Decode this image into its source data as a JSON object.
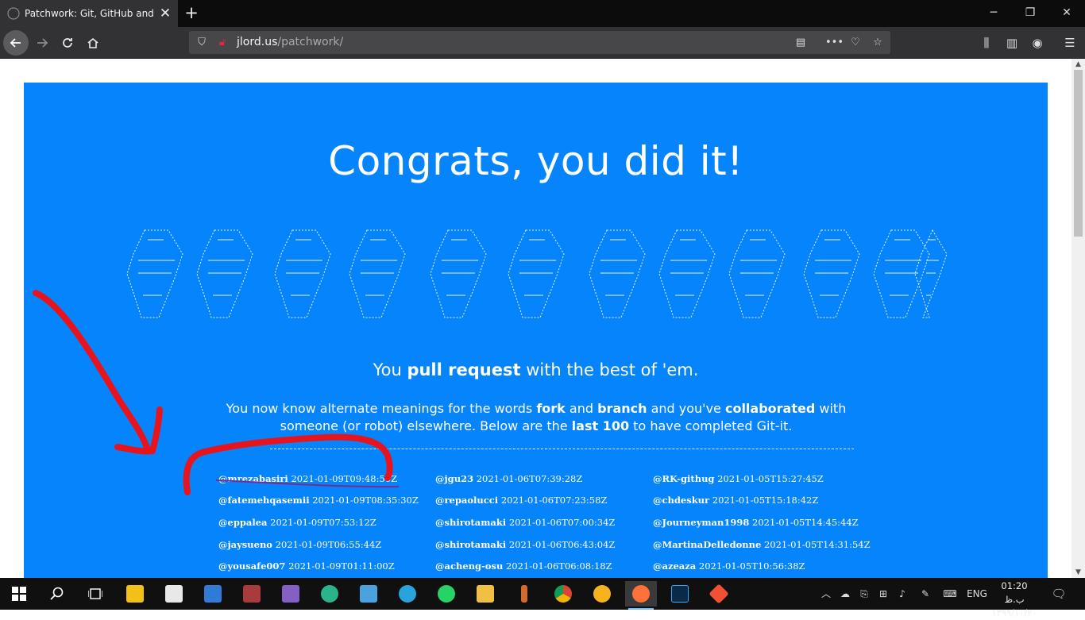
{
  "browser": {
    "tab_title": "Patchwork: Git, GitHub and the",
    "url_host": "jlord.us",
    "url_path": "/patchwork/"
  },
  "page": {
    "heading": "Congrats, you did it!",
    "tagline_prefix": "You ",
    "tagline_bold": "pull request",
    "tagline_suffix": " with the best of 'em.",
    "desc_1": "You now know alternate meanings for the words ",
    "desc_fork": "fork",
    "desc_2": " and ",
    "desc_branch": "branch",
    "desc_3": " and you've ",
    "desc_collab": "collaborated",
    "desc_4": " with someone (or robot) elsewhere. Below are the ",
    "desc_last": "last 100",
    "desc_5": " to have completed Git-it."
  },
  "completions": [
    [
      {
        "user": "@mrezabasiri",
        "time": "2021-01-09T09:48:50Z"
      },
      {
        "user": "@fatemehqasemii",
        "time": "2021-01-09T08:35:30Z"
      },
      {
        "user": "@eppalea",
        "time": "2021-01-09T07:53:12Z"
      },
      {
        "user": "@jaysueno",
        "time": "2021-01-09T06:55:44Z"
      },
      {
        "user": "@yousafe007",
        "time": "2021-01-09T01:11:00Z"
      }
    ],
    [
      {
        "user": "@jgu23",
        "time": "2021-01-06T07:39:28Z"
      },
      {
        "user": "@repaolucci",
        "time": "2021-01-06T07:23:58Z"
      },
      {
        "user": "@shirotamaki",
        "time": "2021-01-06T07:00:34Z"
      },
      {
        "user": "@shirotamaki",
        "time": "2021-01-06T06:43:04Z"
      },
      {
        "user": "@acheng-osu",
        "time": "2021-01-06T06:08:18Z"
      }
    ],
    [
      {
        "user": "@RK-githug",
        "time": "2021-01-05T15:27:45Z"
      },
      {
        "user": "@chdeskur",
        "time": "2021-01-05T15:18:42Z"
      },
      {
        "user": "@Journeyman1998",
        "time": "2021-01-05T14:45:44Z"
      },
      {
        "user": "@MartinaDelledonne",
        "time": "2021-01-05T14:31:54Z"
      },
      {
        "user": "@azeaza",
        "time": "2021-01-05T10:56:38Z"
      }
    ]
  ],
  "taskbar": {
    "apps": [
      "Store",
      "Snipping",
      "Mail",
      "WinRAR",
      "Visual Studio",
      "GitKraken",
      "Remote Desktop",
      "Telegram",
      "WhatsApp",
      "File Explorer",
      "Pencil",
      "Chrome",
      "Weather",
      "Firefox",
      "Photoshop",
      "Git"
    ],
    "lang": "ENG",
    "time": "01:20 ب.ظ",
    "date": "۱۳۹۹/۱۰/۲۰"
  },
  "colors": {
    "card_bg": "#0684fb",
    "annotation": "#e8141d",
    "underline": "#7a2c8c"
  }
}
